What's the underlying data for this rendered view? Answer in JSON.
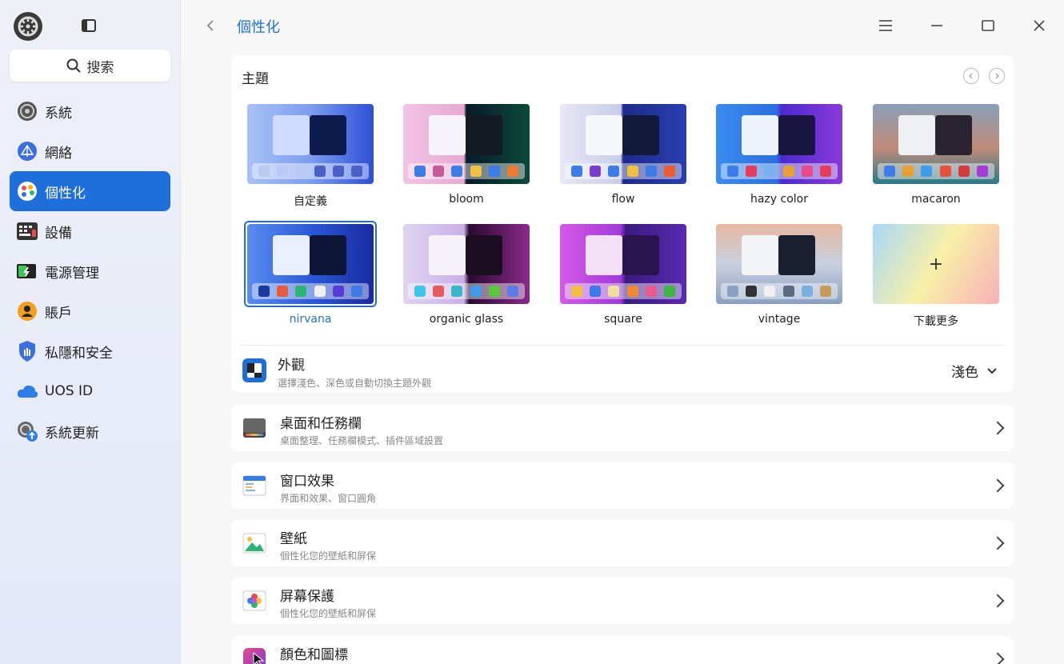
{
  "sidebar": {
    "search_label": "搜索",
    "items": [
      {
        "label": "系統",
        "icon": "system-icon"
      },
      {
        "label": "網絡",
        "icon": "network-icon"
      },
      {
        "label": "個性化",
        "icon": "personalization-icon",
        "active": true
      },
      {
        "label": "設備",
        "icon": "device-icon"
      },
      {
        "label": "電源管理",
        "icon": "power-icon"
      },
      {
        "label": "賬戶",
        "icon": "account-icon"
      },
      {
        "label": "私隱和安全",
        "icon": "shield-icon"
      },
      {
        "label": "UOS ID",
        "icon": "cloud-icon"
      },
      {
        "label": "系統更新",
        "icon": "update-icon"
      }
    ]
  },
  "header": {
    "title": "個性化"
  },
  "theme": {
    "heading": "主題",
    "themes": [
      {
        "name": "自定義"
      },
      {
        "name": "bloom"
      },
      {
        "name": "flow"
      },
      {
        "name": "hazy color"
      },
      {
        "name": "macaron"
      },
      {
        "name": "nirvana",
        "selected": true
      },
      {
        "name": "organic glass"
      },
      {
        "name": "square"
      },
      {
        "name": "vintage"
      },
      {
        "name": "下載更多"
      }
    ],
    "add_glyph": "+"
  },
  "appearance": {
    "title": "外觀",
    "subtitle": "選擇淺色、深色或自動切換主題外觀",
    "value": "淺色"
  },
  "rows": [
    {
      "title": "桌面和任務欄",
      "subtitle": "桌面整理、任務欄模式、插件區域設置"
    },
    {
      "title": "窗口效果",
      "subtitle": "界面和效果、窗口圓角"
    },
    {
      "title": "壁紙",
      "subtitle": "個性化您的壁紙和屏保"
    },
    {
      "title": "屏幕保護",
      "subtitle": "個性化您的壁紙和屏保"
    },
    {
      "title": "顏色和圖標",
      "subtitle": ""
    }
  ],
  "colors": {
    "accent": "#1f6fdb"
  }
}
